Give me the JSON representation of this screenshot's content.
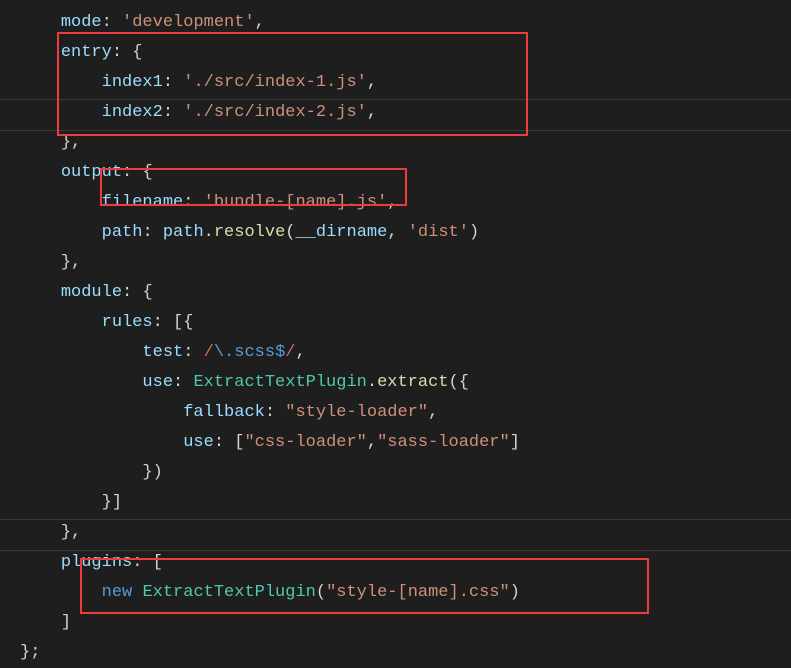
{
  "code": {
    "l1": {
      "indent": "    ",
      "prop": "mode",
      "colon": ": ",
      "val": "'development'",
      "end": ","
    },
    "l2": {
      "indent": "    ",
      "prop": "entry",
      "colon": ": ",
      "brace": "{"
    },
    "l3": {
      "indent": "        ",
      "prop": "index1",
      "colon": ": ",
      "val": "'./src/index-1.js'",
      "end": ","
    },
    "l4": {
      "indent": "        ",
      "prop": "index2",
      "colon": ": ",
      "val": "'./src/index-2.js'",
      "end": ","
    },
    "l5": {
      "indent": "    ",
      "brace": "},"
    },
    "l6": {
      "indent": "    ",
      "prop": "output",
      "colon": ": ",
      "brace": "{"
    },
    "l7": {
      "indent": "        ",
      "prop": "filename",
      "colon": ": ",
      "val": "'bundle-[name].js'",
      "end": ","
    },
    "l8": {
      "indent": "        ",
      "prop": "path",
      "colon": ": ",
      "obj": "path",
      "dot": ".",
      "method": "resolve",
      "open": "(",
      "arg1": "__dirname",
      "comma": ", ",
      "arg2": "'dist'",
      "close": ")"
    },
    "l9": {
      "indent": "    ",
      "brace": "},"
    },
    "l10": {
      "indent": "    ",
      "prop": "module",
      "colon": ": ",
      "brace": "{"
    },
    "l11": {
      "indent": "        ",
      "prop": "rules",
      "colon": ": ",
      "brace": "[{"
    },
    "l12": {
      "indent": "            ",
      "prop": "test",
      "colon": ": ",
      "regex_open": "/",
      "regex_body": "\\.scss",
      "regex_end": "$",
      "regex_close": "/",
      "end": ","
    },
    "l13": {
      "indent": "            ",
      "prop": "use",
      "colon": ": ",
      "class": "ExtractTextPlugin",
      "dot": ".",
      "method": "extract",
      "open": "({"
    },
    "l14": {
      "indent": "                ",
      "prop": "fallback",
      "colon": ": ",
      "val": "\"style-loader\"",
      "end": ","
    },
    "l15": {
      "indent": "                ",
      "prop": "use",
      "colon": ": ",
      "open": "[",
      "v1": "\"css-loader\"",
      "comma": ",",
      "v2": "\"sass-loader\"",
      "close": "]"
    },
    "l16": {
      "indent": "            ",
      "brace": "})"
    },
    "l17": {
      "indent": "        ",
      "brace": "}]"
    },
    "l18": {
      "indent": "    ",
      "brace": "},"
    },
    "l19": {
      "indent": "    ",
      "prop": "plugins",
      "colon": ": ",
      "brace": "["
    },
    "l20": {
      "indent": "        ",
      "keyword": "new ",
      "class": "ExtractTextPlugin",
      "open": "(",
      "val": "\"style-[name].css\"",
      "close": ")"
    },
    "l21": {
      "indent": "    ",
      "brace": "]"
    },
    "l22": {
      "indent": "",
      "brace": "};"
    }
  }
}
